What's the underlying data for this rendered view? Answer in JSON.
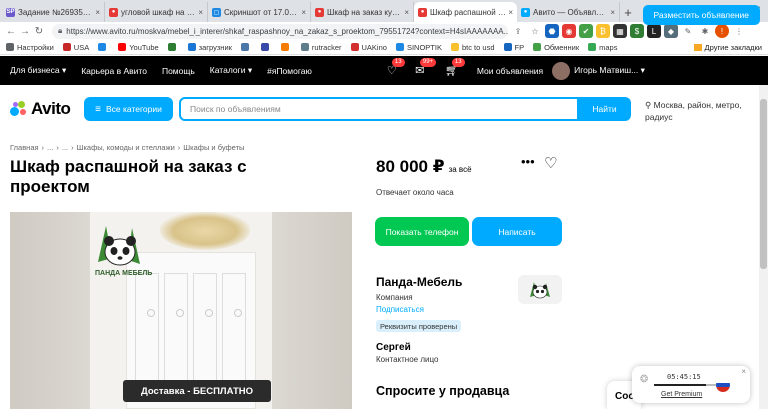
{
  "browser": {
    "tabs": [
      {
        "title": "Задание №2693514 - ...",
        "fav_color": "#6a5acd",
        "fav_text": "SP"
      },
      {
        "title": "угловой шкаф на заказ",
        "fav_color": "#e53935",
        "fav_text": "●"
      },
      {
        "title": "Скриншот от 17.02.2022",
        "fav_color": "#1e88e5",
        "fav_text": "▢"
      },
      {
        "title": "Шкаф на заказ купить",
        "fav_color": "#e53935",
        "fav_text": "●"
      },
      {
        "title": "Шкаф распашной на заказ",
        "fav_color": "#e53935",
        "fav_text": "●"
      },
      {
        "title": "Авито — Объявления",
        "fav_color": "#00aaff",
        "fav_text": "●"
      }
    ],
    "active_tab": 4,
    "url": "https://www.avito.ru/moskva/mebel_i_interer/shkaf_raspashnoy_na_zakaz_s_proektom_79551724?context=H4sIAAAAAAA...",
    "bookmarks": [
      {
        "label": "Настройки",
        "color": "#5f6368"
      },
      {
        "label": "USA",
        "color": "#c62828"
      },
      {
        "label": "",
        "color": "#1e88e5"
      },
      {
        "label": "YouTube",
        "color": "#ff0000"
      },
      {
        "label": "",
        "color": "#2e7d32"
      },
      {
        "label": "загрузник",
        "color": "#1976d2"
      },
      {
        "label": "",
        "color": "#4a76a8"
      },
      {
        "label": "",
        "color": "#3949ab"
      },
      {
        "label": "",
        "color": "#f57c00"
      },
      {
        "label": "rutracker",
        "color": "#607d8b"
      },
      {
        "label": "UAKino",
        "color": "#d32f2f"
      },
      {
        "label": "SINOPTIK",
        "color": "#1e88e5"
      },
      {
        "label": "btc to usd",
        "color": "#fbc02d"
      },
      {
        "label": "FP",
        "color": "#1565c0"
      },
      {
        "label": "Обменник",
        "color": "#43a047"
      },
      {
        "label": "maps",
        "color": "#34a853"
      }
    ],
    "other_bookmarks": "Другие закладки"
  },
  "topbar": {
    "business": "Для бизнеса",
    "career": "Карьера в Авито",
    "help": "Помощь",
    "catalogs": "Каталоги",
    "ihelp": "#яПомогаю",
    "badge_favorites": "13",
    "badge_messages": "99+",
    "badge_cart": "13",
    "my_ads": "Мои объявления",
    "user": "Игорь Матвиш...",
    "place_ad": "Разместить объявление"
  },
  "search": {
    "logo": "Avito",
    "categories": "Все категории",
    "placeholder": "Поиск по объявлениям",
    "find": "Найти",
    "location": "Москва, район, метро, радиус"
  },
  "breadcrumbs": [
    "Главная",
    "...",
    "...",
    "Шкафы, комоды и стеллажи",
    "Шкафы и буфеты"
  ],
  "listing": {
    "title": "Шкаф распашной на заказ с проектом",
    "photo_brand": "ПАНДА МЕБЕЛЬ",
    "photo_banner": "Доставка - БЕСПЛАТНО",
    "price": "80 000 ₽",
    "price_suffix": "за всё",
    "reply_time": "Отвечает около часа",
    "call_btn": "Показать телефон",
    "write_btn": "Написать"
  },
  "seller": {
    "name": "Панда-Мебель",
    "type": "Компания",
    "subscribe": "Подписаться",
    "verified": "Реквизиты проверены",
    "contact_name": "Сергей",
    "contact_role": "Контактное лицо",
    "ask_title": "Спросите у продавца"
  },
  "widgets": {
    "chat_peek": "Соо",
    "vpn_time": "05:45:15",
    "vpn_link": "Get Premium"
  },
  "colors": {
    "accent": "#00aaff",
    "call_green": "#00c853",
    "dark_bar": "#000000"
  }
}
